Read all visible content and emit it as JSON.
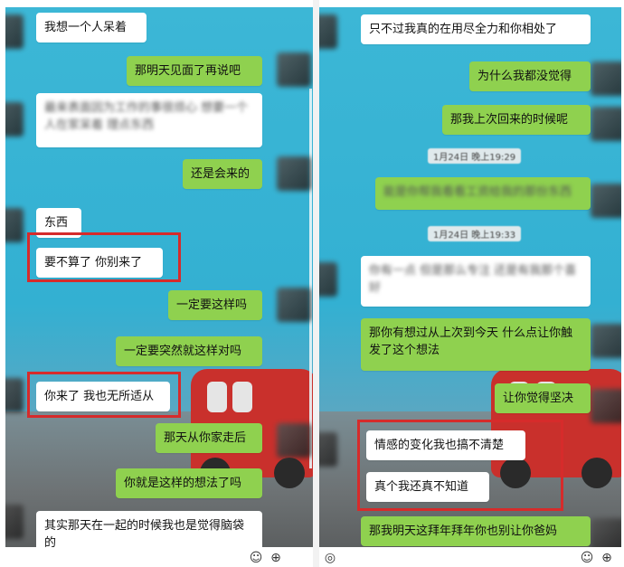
{
  "left": {
    "messages": [
      {
        "side": "left",
        "text": "我想一个人呆着"
      },
      {
        "side": "right",
        "text": "那明天见面了再说吧"
      },
      {
        "side": "left",
        "text": "最来表面因为工作的事很烦心 想要一个人在家呆着 理点东西",
        "blurred": true
      },
      {
        "side": "right",
        "text": "还是会来的"
      },
      {
        "side": "left",
        "text": "东西"
      },
      {
        "side": "left",
        "text": "要不算了 你别来了"
      },
      {
        "side": "right",
        "text": "一定要这样吗"
      },
      {
        "side": "right",
        "text": "一定要突然就这样对吗"
      },
      {
        "side": "left",
        "text": "你来了 我也无所适从"
      },
      {
        "side": "right",
        "text": "那天从你家走后"
      },
      {
        "side": "right",
        "text": "你就是这样的想法了吗"
      },
      {
        "side": "left",
        "text": "其实那天在一起的时候我也是觉得脑袋的"
      }
    ]
  },
  "right": {
    "messages": [
      {
        "side": "left",
        "text": "只不过我真的在用尽全力和你相处了"
      },
      {
        "side": "right",
        "text": "为什么我都没觉得"
      },
      {
        "side": "right",
        "text": "那我上次回来的时候呢"
      },
      {
        "side": "right",
        "text": "能是你帮我看看工资给我的那份东西",
        "blurred": true
      },
      {
        "side": "left",
        "text": "你有一点 但是那么专注 还是有我那个喜好",
        "blurred": true
      },
      {
        "side": "right",
        "text": "那你有想过从上次到今天 什么点让你触发了这个想法"
      },
      {
        "side": "right",
        "text": "让你觉得坚决"
      },
      {
        "side": "left",
        "text": "情感的变化我也搞不清楚"
      },
      {
        "side": "left",
        "text": "真个我还真不知道"
      },
      {
        "side": "right",
        "text": "那我明天这拜年拜年你也别让你爸妈"
      }
    ],
    "timestamps": [
      "1月24日 晚上19:29",
      "1月24日 晚上19:33"
    ]
  },
  "icons": [
    "emoji-icon",
    "add-icon",
    "voice-icon"
  ],
  "colors": {
    "sent_bubble": "#8fd14f",
    "received_bubble": "#ffffff",
    "highlight": "#d62b2b",
    "chat_background": "#3cb7d6"
  }
}
